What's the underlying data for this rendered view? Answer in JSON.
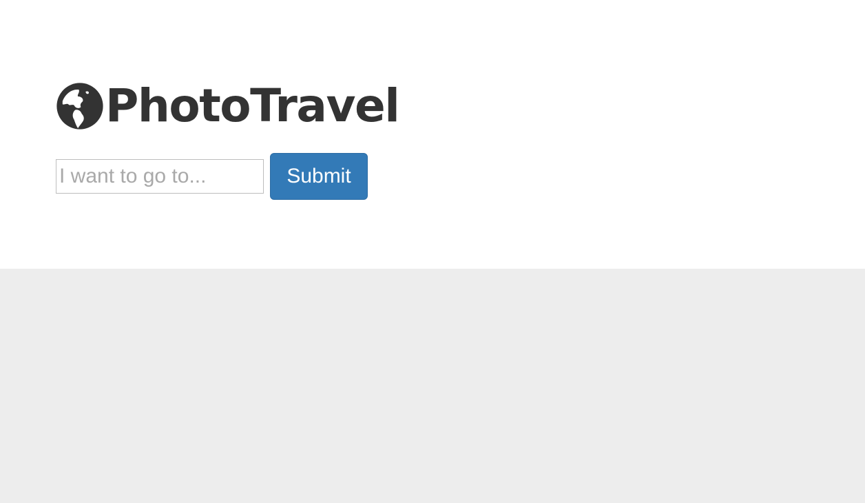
{
  "brand": {
    "name": "PhotoTravel",
    "icon": "globe-icon",
    "color": "#333333"
  },
  "search": {
    "placeholder": "I want to go to...",
    "value": "",
    "submit_label": "Submit"
  },
  "colors": {
    "accent": "#337ab7",
    "content_background": "#ededed"
  }
}
